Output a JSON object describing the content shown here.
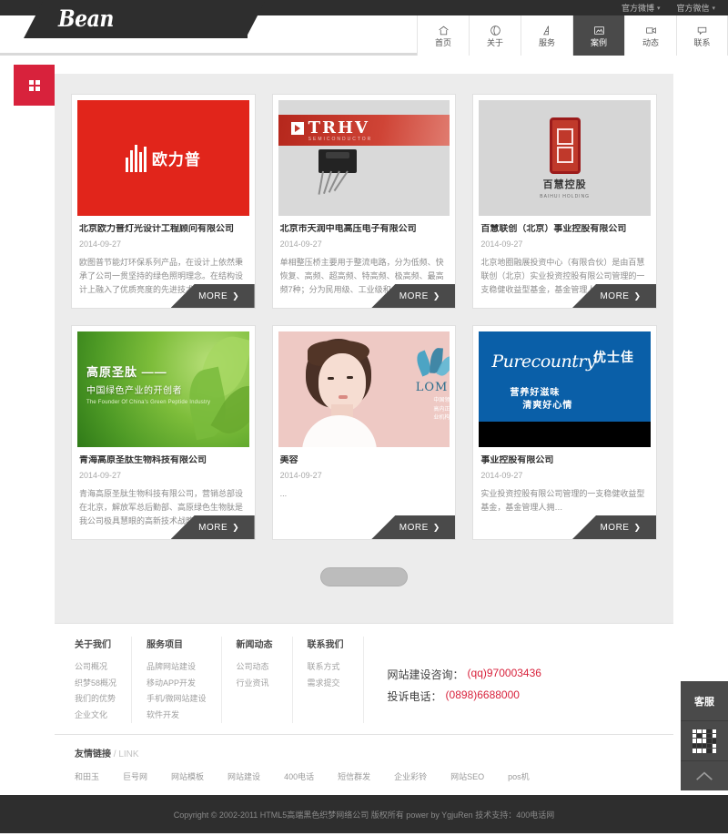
{
  "topbar": {
    "items": [
      {
        "label": "官方微博",
        "icon": "chevron-down-icon"
      },
      {
        "label": "官方微信",
        "icon": "chevron-down-icon"
      }
    ]
  },
  "header": {
    "logo": "Bean",
    "nav": [
      {
        "label": "首页",
        "icon": "home-icon",
        "active": false
      },
      {
        "label": "关于",
        "icon": "about-icon",
        "active": false
      },
      {
        "label": "服务",
        "icon": "service-icon",
        "active": false
      },
      {
        "label": "案例",
        "icon": "cases-icon",
        "active": true
      },
      {
        "label": "动态",
        "icon": "video-icon",
        "active": false
      },
      {
        "label": "联系",
        "icon": "chat-icon",
        "active": false
      }
    ]
  },
  "section": {
    "badge_icon": "grid-icon",
    "badge_color": "#d8223c",
    "more_label": "MORE"
  },
  "cases": [
    {
      "title": "北京欧力普灯光设计工程顾问有限公司",
      "date": "2014-09-27",
      "desc": "欧图普节能灯环保系列产品，在设计上依然秉承了公司一贯坚持的绿色照明理念。在结构设计上融入了优质亮度的先进技术…",
      "thumb_logo_text": "欧力普",
      "thumb_bg": "#e1251b"
    },
    {
      "title": "北京市天润中电高压电子有限公司",
      "date": "2014-09-27",
      "desc": "单相整压桥主要用于整流电路，分为低频、快恢复、高频、超高频、特高频、极高频、最高频7种；分为民用级、工业级和…",
      "thumb_logo_text": "TRHV",
      "thumb_sub_text": "SEMICONDUCTOR",
      "thumb_bg": "#d9d9d9"
    },
    {
      "title": "百慧联创（北京）事业控股有限公司",
      "date": "2014-09-27",
      "desc": "北京地圈融展投资中心（有限合伙）是由百慧联创（北京）实业投资控股有限公司管理的一支稳健收益型基金，基金管理人拥…",
      "thumb_logo_text": "百慧控股",
      "thumb_sub_text": "BAIHUI HOLDING",
      "thumb_bg": "#d6d6d6"
    },
    {
      "title": "青海高原圣肽生物科技有限公司",
      "date": "2014-09-27",
      "desc": "青海高原圣肽生物科技有限公司，营销总部设在北京，解放军总后勤部、高原绿色生物肽是我公司极具慧眼的高新技术战略……",
      "thumb_logo_text": "高原圣肽 ——",
      "thumb_sub_text": "中国绿色产业的开创者",
      "thumb_en_text": "The Founder Of China's Green Peptide Industry",
      "thumb_bg": "#6aa92f"
    },
    {
      "title": "美容",
      "date": "2014-09-27",
      "desc": "...",
      "thumb_logo_text": "LOM",
      "thumb_bg": "#eec9c4"
    },
    {
      "title": "事业控股有限公司",
      "date": "2014-09-27",
      "desc": "实业投资控股有限公司管理的一支稳健收益型基金，基金管理人拥…",
      "thumb_logo_text": "Purecountry",
      "thumb_sub_text": "优士佳",
      "thumb_slogan_1": "营养好滋味",
      "thumb_slogan_2": "清爽好心情",
      "thumb_bg": "#0a5fa8"
    }
  ],
  "footer": {
    "columns": [
      {
        "title": "关于我们",
        "links": [
          "公司概况",
          "织梦58概况",
          "我们的优势",
          "企业文化"
        ]
      },
      {
        "title": "服务项目",
        "links": [
          "品牌网站建设",
          "移动APP开发",
          "手机/微网站建设",
          "软件开发"
        ]
      },
      {
        "title": "新闻动态",
        "links": [
          "公司动态",
          "行业资讯"
        ]
      },
      {
        "title": "联系我们",
        "links": [
          "联系方式",
          "需求提交"
        ]
      }
    ],
    "contact": [
      {
        "label": "网站建设咨询：",
        "value": "(qq)970003436"
      },
      {
        "label": "投诉电话：",
        "value": "(0898)6688000"
      }
    ]
  },
  "friendly_links": {
    "title_zh": "友情链接",
    "title_en": "/ LINK",
    "links": [
      "和田玉",
      "巨号网",
      "网站模板",
      "网站建设",
      "400电话",
      "短信群发",
      "企业彩铃",
      "网站SEO",
      "pos机"
    ]
  },
  "copyright": {
    "text": "Copyright © 2002-2011 HTML5高端黑色织梦网络公司 版权所有 power by YgjuRen 技术支持：400电话网"
  },
  "side_widget": {
    "kefu_label": "客服",
    "qr_icon": "qr-code-icon",
    "top_icon": "chevron-up-icon"
  }
}
